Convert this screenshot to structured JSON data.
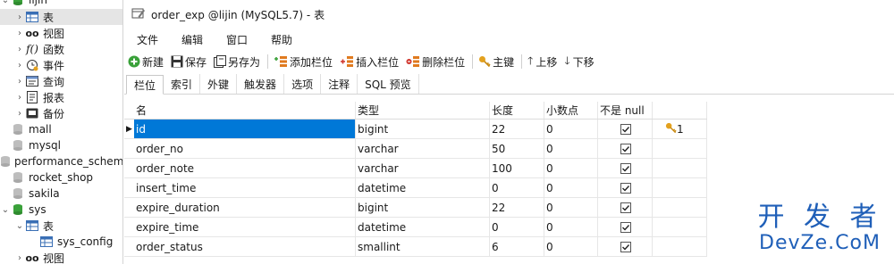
{
  "tree": {
    "rows": [
      {
        "label": "lijin",
        "indent": 0
      },
      {
        "label": "表",
        "indent": 1
      },
      {
        "label": "视图",
        "indent": 1
      },
      {
        "label": "函数",
        "indent": 1
      },
      {
        "label": "事件",
        "indent": 1
      },
      {
        "label": "查询",
        "indent": 1
      },
      {
        "label": "报表",
        "indent": 1
      },
      {
        "label": "备份",
        "indent": 1
      },
      {
        "label": "mall",
        "indent": 0
      },
      {
        "label": "mysql",
        "indent": 0
      },
      {
        "label": "performance_schema",
        "indent": 0
      },
      {
        "label": "rocket_shop",
        "indent": 0
      },
      {
        "label": "sakila",
        "indent": 0
      },
      {
        "label": "sys",
        "indent": 0
      },
      {
        "label": "表",
        "indent": 1
      },
      {
        "label": "sys_config",
        "indent": 2
      },
      {
        "label": "视图",
        "indent": 1
      }
    ]
  },
  "window": {
    "title": "order_exp @lijin (MySQL5.7) - 表"
  },
  "menu": {
    "file": "文件",
    "edit": "编辑",
    "window": "窗口",
    "help": "帮助"
  },
  "toolbar": {
    "new": "新建",
    "save": "保存",
    "save_as": "另存为",
    "add_column": "添加栏位",
    "insert_column": "插入栏位",
    "delete_column": "删除栏位",
    "primary_key": "主键",
    "move_up": "上移",
    "move_down": "下移"
  },
  "tabs": [
    "栏位",
    "索引",
    "外键",
    "触发器",
    "选项",
    "注释",
    "SQL 预览"
  ],
  "grid": {
    "headers": {
      "name": "名",
      "type": "类型",
      "length": "长度",
      "decimals": "小数点",
      "not_null": "不是 null"
    },
    "rows": [
      {
        "name": "id",
        "type": "bigint",
        "length": "22",
        "decimals": "0",
        "not_null": true,
        "key": "1"
      },
      {
        "name": "order_no",
        "type": "varchar",
        "length": "50",
        "decimals": "0",
        "not_null": true,
        "key": ""
      },
      {
        "name": "order_note",
        "type": "varchar",
        "length": "100",
        "decimals": "0",
        "not_null": true,
        "key": ""
      },
      {
        "name": "insert_time",
        "type": "datetime",
        "length": "0",
        "decimals": "0",
        "not_null": true,
        "key": ""
      },
      {
        "name": "expire_duration",
        "type": "bigint",
        "length": "22",
        "decimals": "0",
        "not_null": true,
        "key": ""
      },
      {
        "name": "expire_time",
        "type": "datetime",
        "length": "0",
        "decimals": "0",
        "not_null": true,
        "key": ""
      },
      {
        "name": "order_status",
        "type": "smallint",
        "length": "6",
        "decimals": "0",
        "not_null": true,
        "key": ""
      }
    ]
  },
  "watermark": {
    "line1": "开 发 者",
    "line2": "DevZe.CoM"
  }
}
